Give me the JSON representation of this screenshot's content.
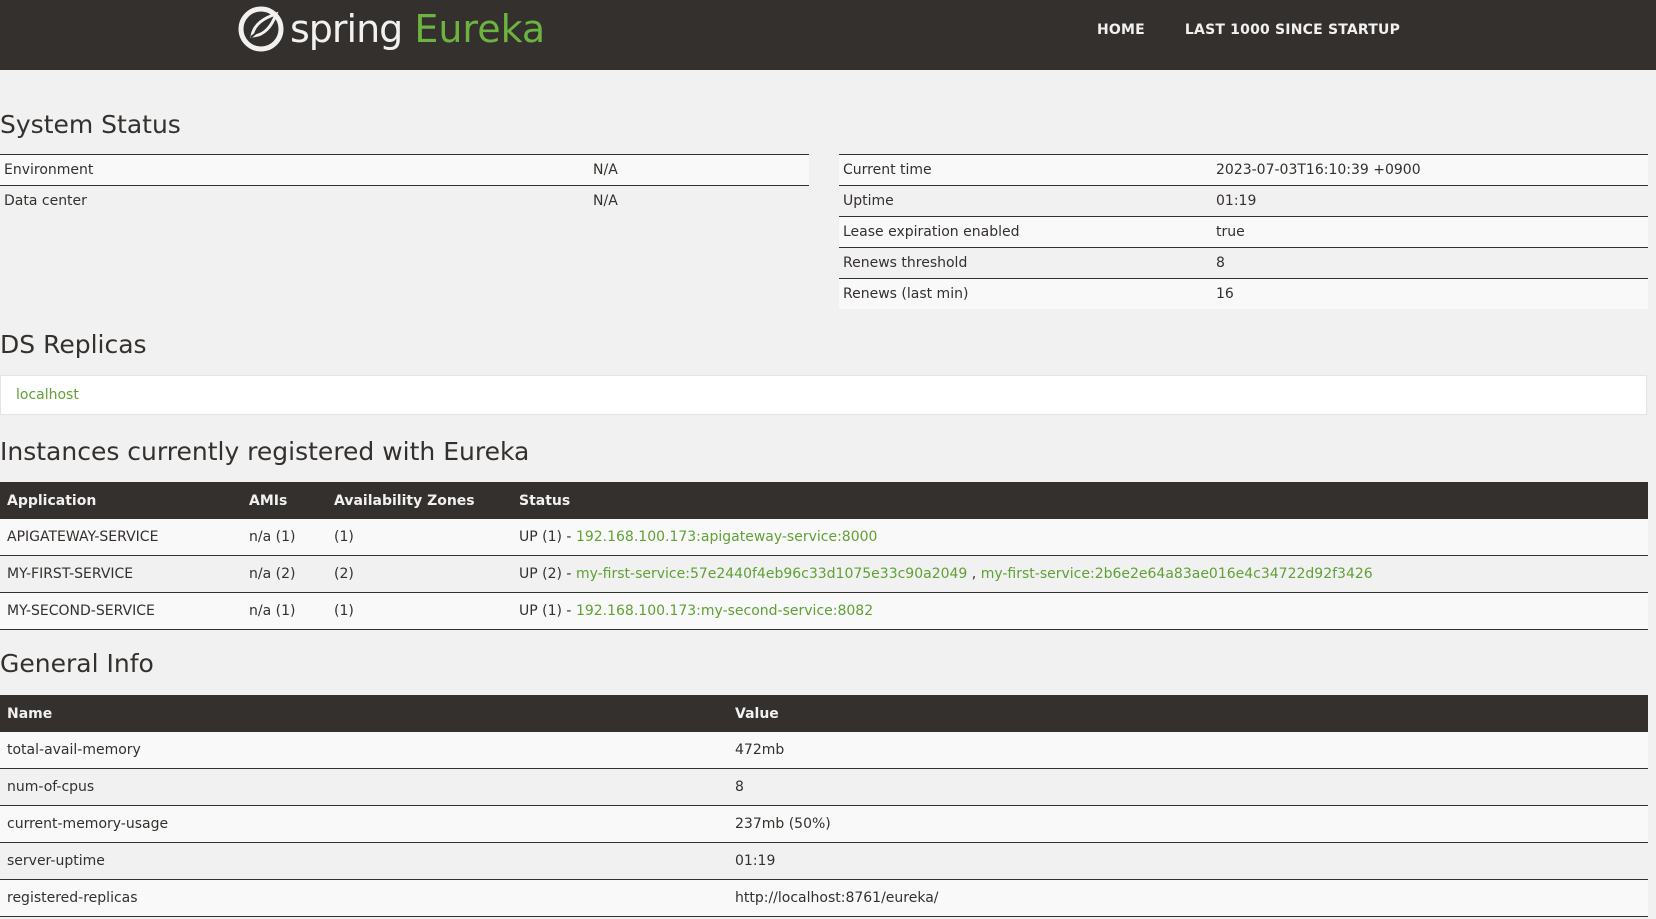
{
  "header": {
    "logo_word": "spring",
    "logo_product": "Eureka",
    "nav": [
      "HOME",
      "LAST 1000 SINCE STARTUP"
    ]
  },
  "system_status": {
    "title": "System Status",
    "left": [
      {
        "label": "Environment",
        "value": "N/A"
      },
      {
        "label": "Data center",
        "value": "N/A"
      }
    ],
    "right": [
      {
        "label": "Current time",
        "value": "2023-07-03T16:10:39 +0900"
      },
      {
        "label": "Uptime",
        "value": "01:19"
      },
      {
        "label": "Lease expiration enabled",
        "value": "true"
      },
      {
        "label": "Renews threshold",
        "value": "8"
      },
      {
        "label": "Renews (last min)",
        "value": "16"
      }
    ]
  },
  "ds_replicas": {
    "title": "DS Replicas",
    "items": [
      "localhost"
    ]
  },
  "instances": {
    "title": "Instances currently registered with Eureka",
    "columns": [
      "Application",
      "AMIs",
      "Availability Zones",
      "Status"
    ],
    "rows": [
      {
        "application": "APIGATEWAY-SERVICE",
        "amis": "n/a (1)",
        "zones": "(1)",
        "status": "UP (1) - ",
        "links": [
          "192.168.100.173:apigateway-service:8000"
        ]
      },
      {
        "application": "MY-FIRST-SERVICE",
        "amis": "n/a (2)",
        "zones": "(2)",
        "status": "UP (2) - ",
        "links": [
          "my-first-service:57e2440f4eb96c33d1075e33c90a2049",
          "my-first-service:2b6e2e64a83ae016e4c34722d92f3426"
        ]
      },
      {
        "application": "MY-SECOND-SERVICE",
        "amis": "n/a (1)",
        "zones": "(1)",
        "status": "UP (1) - ",
        "links": [
          "192.168.100.173:my-second-service:8082"
        ]
      }
    ],
    "link_separator": " , "
  },
  "general_info": {
    "title": "General Info",
    "columns": [
      "Name",
      "Value"
    ],
    "rows": [
      {
        "name": "total-avail-memory",
        "value": "472mb"
      },
      {
        "name": "num-of-cpus",
        "value": "8"
      },
      {
        "name": "current-memory-usage",
        "value": "237mb (50%)"
      },
      {
        "name": "server-uptime",
        "value": "01:19"
      },
      {
        "name": "registered-replicas",
        "value": "http://localhost:8761/eureka/"
      }
    ]
  },
  "colors": {
    "header_bg": "#34302d",
    "page_bg": "#f1f1f1",
    "accent_green": "#6db33f",
    "link_green": "#5fa134"
  }
}
